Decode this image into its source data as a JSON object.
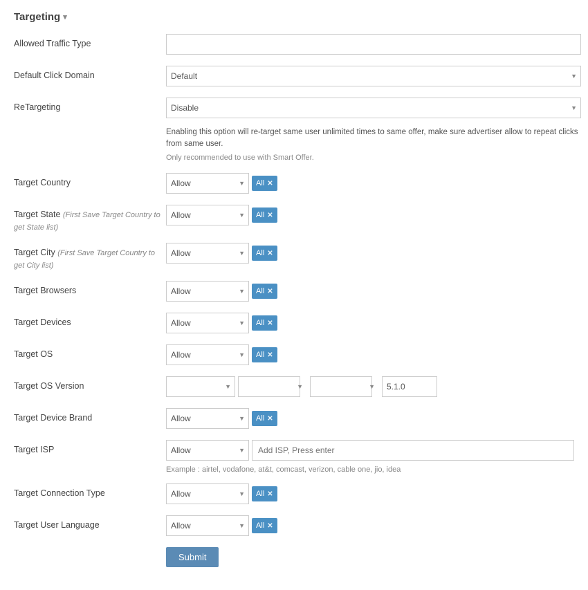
{
  "page": {
    "title": "Targeting",
    "chevron": "▾"
  },
  "fields": {
    "allowed_traffic_type": {
      "label": "Allowed Traffic Type",
      "placeholder": ""
    },
    "default_click_domain": {
      "label": "Default Click Domain",
      "options": [
        "Default"
      ],
      "selected": "Default"
    },
    "retargeting": {
      "label": "ReTargeting",
      "options": [
        "Disable"
      ],
      "selected": "Disable",
      "info_line1": "Enabling this option will re-target same user unlimited times to same offer, make sure advertiser allow to repeat clicks from same user.",
      "info_line2": "Only recommended to use with Smart Offer."
    },
    "target_country": {
      "label": "Target Country",
      "allow_label": "Allow",
      "badge": "All"
    },
    "target_state": {
      "label": "Target State",
      "sublabel": "(First Save Target Country to get State list)",
      "allow_label": "Allow",
      "badge": "All"
    },
    "target_city": {
      "label": "Target City",
      "sublabel": "(First Save Target Country to get City list)",
      "allow_label": "Allow",
      "badge": "All"
    },
    "target_browsers": {
      "label": "Target Browsers",
      "allow_label": "Allow",
      "badge": "All"
    },
    "target_devices": {
      "label": "Target Devices",
      "allow_label": "Allow",
      "badge": "All"
    },
    "target_os": {
      "label": "Target OS",
      "allow_label": "Allow",
      "badge": "All"
    },
    "target_os_version": {
      "label": "Target OS Version",
      "version_value": "5.1.0"
    },
    "target_device_brand": {
      "label": "Target Device Brand",
      "allow_label": "Allow",
      "badge": "All"
    },
    "target_isp": {
      "label": "Target ISP",
      "allow_label": "Allow",
      "isp_placeholder": "Add ISP, Press enter",
      "example": "Example : airtel, vodafone, at&t, comcast, verizon, cable one, jio, idea"
    },
    "target_connection_type": {
      "label": "Target Connection Type",
      "allow_label": "Allow",
      "badge": "All"
    },
    "target_user_language": {
      "label": "Target User Language",
      "allow_label": "Allow",
      "badge": "All"
    }
  },
  "submit": {
    "label": "Submit"
  }
}
